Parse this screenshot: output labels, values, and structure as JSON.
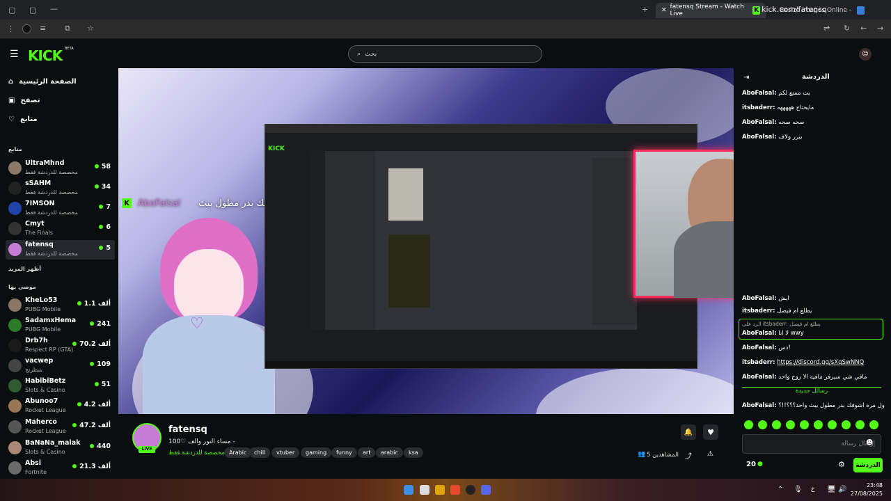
{
  "browser": {
    "tabs": [
      {
        "label": "fatensq Stream - Watch Live",
        "active": true
      },
      {
        "label": "Resize Images Online - Resize",
        "active": false
      }
    ],
    "url": "kick.com/fatensq"
  },
  "header": {
    "logo": "KICK",
    "beta": "BETA",
    "search_placeholder": "بحث"
  },
  "sidebar": {
    "nav": [
      {
        "label": "الصفحة الرئيسية",
        "icon": "home-icon"
      },
      {
        "label": "تصفح",
        "icon": "browse-icon"
      },
      {
        "label": "متابع",
        "icon": "heart-icon"
      }
    ],
    "following_title": "متابع",
    "following": [
      {
        "name": "UltraMhnd",
        "category": "مخصصة للدردشة فقط",
        "viewers": "58"
      },
      {
        "name": "sSAHM",
        "category": "مخصصة للدردشة فقط",
        "viewers": "34"
      },
      {
        "name": "7IMSON",
        "category": "مخصصة للدردشة فقط",
        "viewers": "7"
      },
      {
        "name": "Cmyt",
        "category": "The Finals",
        "viewers": "6"
      },
      {
        "name": "fatensq",
        "category": "مخصصة للدردشة فقط",
        "viewers": "5"
      }
    ],
    "show_more": "أظهر المزيد",
    "recommended_title": "موصى بها",
    "recommended": [
      {
        "name": "KheLo53",
        "category": "PUBG Mobile",
        "viewers": "1.1 ألف"
      },
      {
        "name": "SadamxHema",
        "category": "PUBG Mobile",
        "viewers": "241"
      },
      {
        "name": "Drb7h",
        "category": "Respect RP (GTA)",
        "viewers": "70.2 ألف"
      },
      {
        "name": "vacwep",
        "category": "شطرنج",
        "viewers": "109"
      },
      {
        "name": "HabibiBetz",
        "category": "Slots & Casino",
        "viewers": "51"
      },
      {
        "name": "Abunoo7",
        "category": "Rocket League",
        "viewers": "4.2 ألف"
      },
      {
        "name": "Maherco",
        "category": "Rocket League",
        "viewers": "47.2 ألف"
      },
      {
        "name": "BaNaNa_malak",
        "category": "Slots & Casino",
        "viewers": "440"
      },
      {
        "name": "Absi",
        "category": "Fortnite",
        "viewers": "21.3 ألف"
      }
    ]
  },
  "video": {
    "overlay_name": "AboFalsal",
    "overlay_text": "اول مره اشوفك بدر مطول بيث"
  },
  "stream": {
    "channel": "fatensq",
    "title": "مساء النور والف ♡100 -",
    "category": "مخصصة للدردشة فقط",
    "live": "LIVE",
    "tags": [
      "Arabic",
      "chill",
      "vtuber",
      "gaming",
      "funny",
      "art",
      "arabic",
      "ksa"
    ],
    "viewers_label": "المشاهدين 5"
  },
  "chat": {
    "title": "الدردشة",
    "messages_top": [
      {
        "user": "AboFalsal:",
        "text": "بث ممتع لكم"
      },
      {
        "user": "itsbaderr:",
        "text": "مايحتاج هههههه"
      },
      {
        "user": "AboFalsal:",
        "text": "صحه صحه"
      },
      {
        "user": "AboFalsal:",
        "text": "بيرر ولاف"
      }
    ],
    "messages_bottom": [
      {
        "user": "AboFalsal:",
        "text": "ايش"
      },
      {
        "user": "itsbaderr:",
        "text": "يطلع ام فيصل"
      }
    ],
    "reply_preview": "الرد على itsbaderr: يطلع ام فيصل",
    "reply": {
      "user": "AboFalsal:",
      "text": "لا انا wwy"
    },
    "messages_after": [
      {
        "user": "AboFalsal:",
        "text": "دس!"
      },
      {
        "user": "itsbaderr:",
        "text": "https://discord.gg/sXqSwNNQ"
      },
      {
        "user": "AboFalsal:",
        "text": "مافي شي سيرفر مافيه الا زوج واحد"
      }
    ],
    "new_messages": "رسائل جديدة",
    "latest": {
      "user": "AboFalsal:",
      "text": "اول مره اشوفك بدر مطول بيث واحد؟؟؟!!؟"
    },
    "input_placeholder": "إرسال رسالة",
    "points": "20",
    "send": "الدردشة"
  },
  "taskbar": {
    "time": "23:48",
    "date": "27/08/2025"
  }
}
